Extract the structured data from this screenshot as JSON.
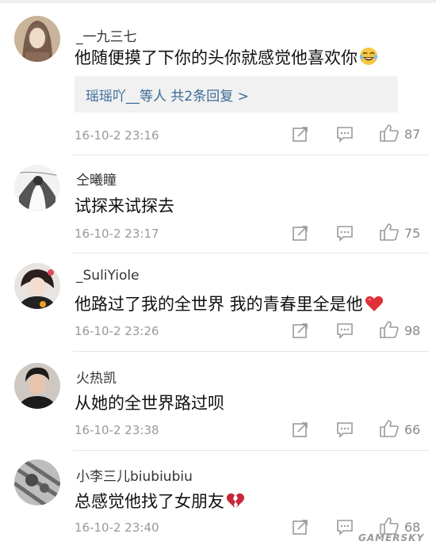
{
  "comments": [
    {
      "username": "_一九三七",
      "text": "他随便摸了下你的头你就感觉他喜欢你",
      "emoji": "laughing-tears-emoji",
      "reply_link": "瑶瑶吖__等人  共2条回复 >",
      "time": "16-10-2 23:16",
      "likes": "87"
    },
    {
      "username": "仝曦瞳",
      "text": "试探来试探去",
      "time": "16-10-2 23:17",
      "likes": "75"
    },
    {
      "username": "_SuliYiole",
      "text": "他路过了我的全世界 我的青春里全是他",
      "emoji": "red-heart-emoji",
      "time": "16-10-2 23:26",
      "likes": "98"
    },
    {
      "username": "火热凯",
      "text": "从她的全世界路过呗",
      "time": "16-10-2 23:38",
      "likes": "66"
    },
    {
      "username": "小李三儿biubiubiu",
      "text": "总感觉他找了女朋友",
      "emoji": "broken-heart-emoji",
      "time": "16-10-2 23:40",
      "likes": "68"
    }
  ],
  "icons": {
    "forward": "forward-icon",
    "reply": "comment-icon",
    "like": "thumbs-up-icon"
  },
  "colors": {
    "link": "#3d6a9a",
    "meta": "#999999",
    "reply_box": "#f1f1f1",
    "heart": "#e0313b"
  },
  "watermark": "GAMERSKY"
}
